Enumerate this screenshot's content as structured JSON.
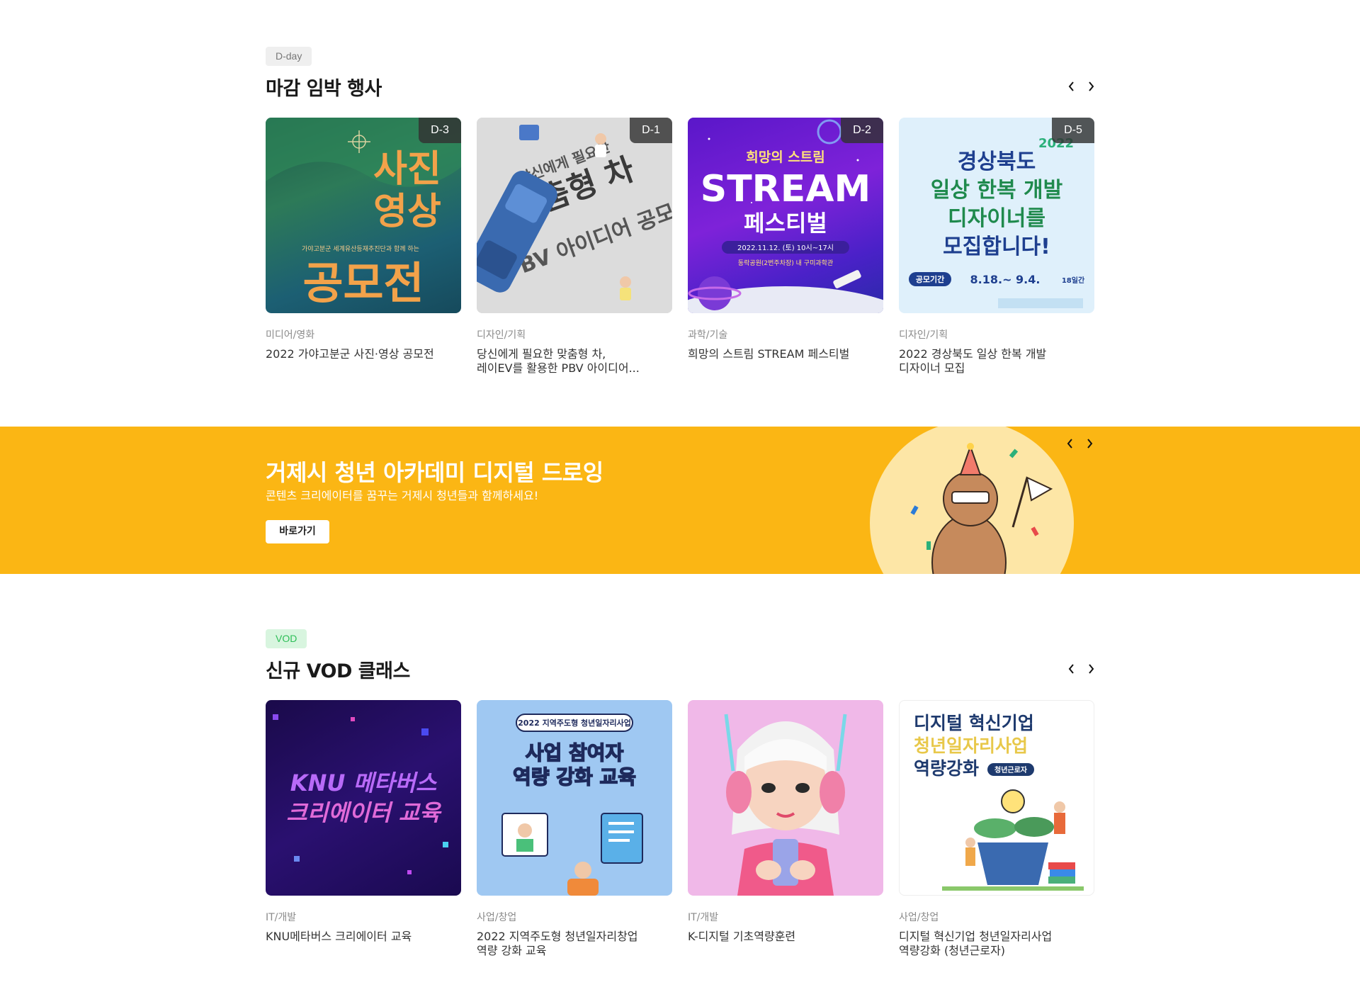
{
  "dday_section": {
    "tag": "D-day",
    "title": "마감 임박 행사",
    "cards": [
      {
        "badge": "D-3",
        "category": "미디어/영화",
        "title": "2022 가야고분군 사진·영상 공모전",
        "poster": {
          "l1": "사진",
          "l2": "영상",
          "l3": "공모전",
          "small": "가야고분군 세계유산등재추진단과 함께 하는"
        }
      },
      {
        "badge": "D-1",
        "category": "디자인/기획",
        "title": "당신에게 필요한 맞춤형 차,\n레이EV를 활용한 PBV 아이디어...",
        "poster": {
          "l1": "당신에게 필요한",
          "l2": "맞춤형 차",
          "l3": "PBV 아이디어 공모전"
        }
      },
      {
        "badge": "D-2",
        "category": "과학/기술",
        "title": "희망의 스트림 STREAM 페스티벌",
        "poster": {
          "l1": "희망의 스트림",
          "l2": "STREAM",
          "l3": "페스티벌",
          "date": "2022.11.12. (토) 10시~17시",
          "place": "동락공원(2번주차장) 내 구미과학관"
        }
      },
      {
        "badge": "D-5",
        "category": "디자인/기획",
        "title": "2022 경상북도 일상 한복 개발\n디자이너 모집",
        "poster": {
          "year": "2022",
          "l1": "경상북도",
          "l2": "일상 한복 개발",
          "l3": "디자이너를",
          "l4": "모집합니다!",
          "period_label": "공모기간",
          "period": "8.18.~ 9.4.",
          "days": "18일간"
        }
      }
    ]
  },
  "banner": {
    "title": "거제시 청년 아카데미 디지털 드로잉",
    "subtitle": "콘텐츠 크리에이터를 꿈꾸는 거제시 청년들과 함께하세요!",
    "button": "바로가기"
  },
  "vod_section": {
    "tag": "VOD",
    "title": "신규 VOD 클래스",
    "cards": [
      {
        "category": "IT/개발",
        "title": "KNU메타버스 크리에이터 교육",
        "poster": {
          "l1": "KNU 메타버스",
          "l2": "크리에이터 교육"
        }
      },
      {
        "category": "사업/창업",
        "title": "2022 지역주도형 청년일자리창업\n역량 강화 교육",
        "poster": {
          "pill": "2022 지역주도형 청년일자리사업",
          "l1": "사업 참여자",
          "l2": "역량 강화 교육"
        }
      },
      {
        "category": "IT/개발",
        "title": "K-디지털 기초역량훈련",
        "poster": {}
      },
      {
        "category": "사업/창업",
        "title": "디지털 혁신기업 청년일자리사업\n역량강화 (청년근로자)",
        "poster": {
          "l1": "디지털 혁신기업",
          "l2": "청년일자리사업",
          "l3": "역량강화",
          "tag": "청년근로자"
        }
      }
    ]
  },
  "colors": {
    "banner_bg": "#fbb614",
    "vod_tag_bg": "#d8f5df",
    "vod_tag_fg": "#2dbe57",
    "dday_tag_bg": "#efefef"
  },
  "icons": [
    "chevron-left-icon",
    "chevron-right-icon"
  ]
}
